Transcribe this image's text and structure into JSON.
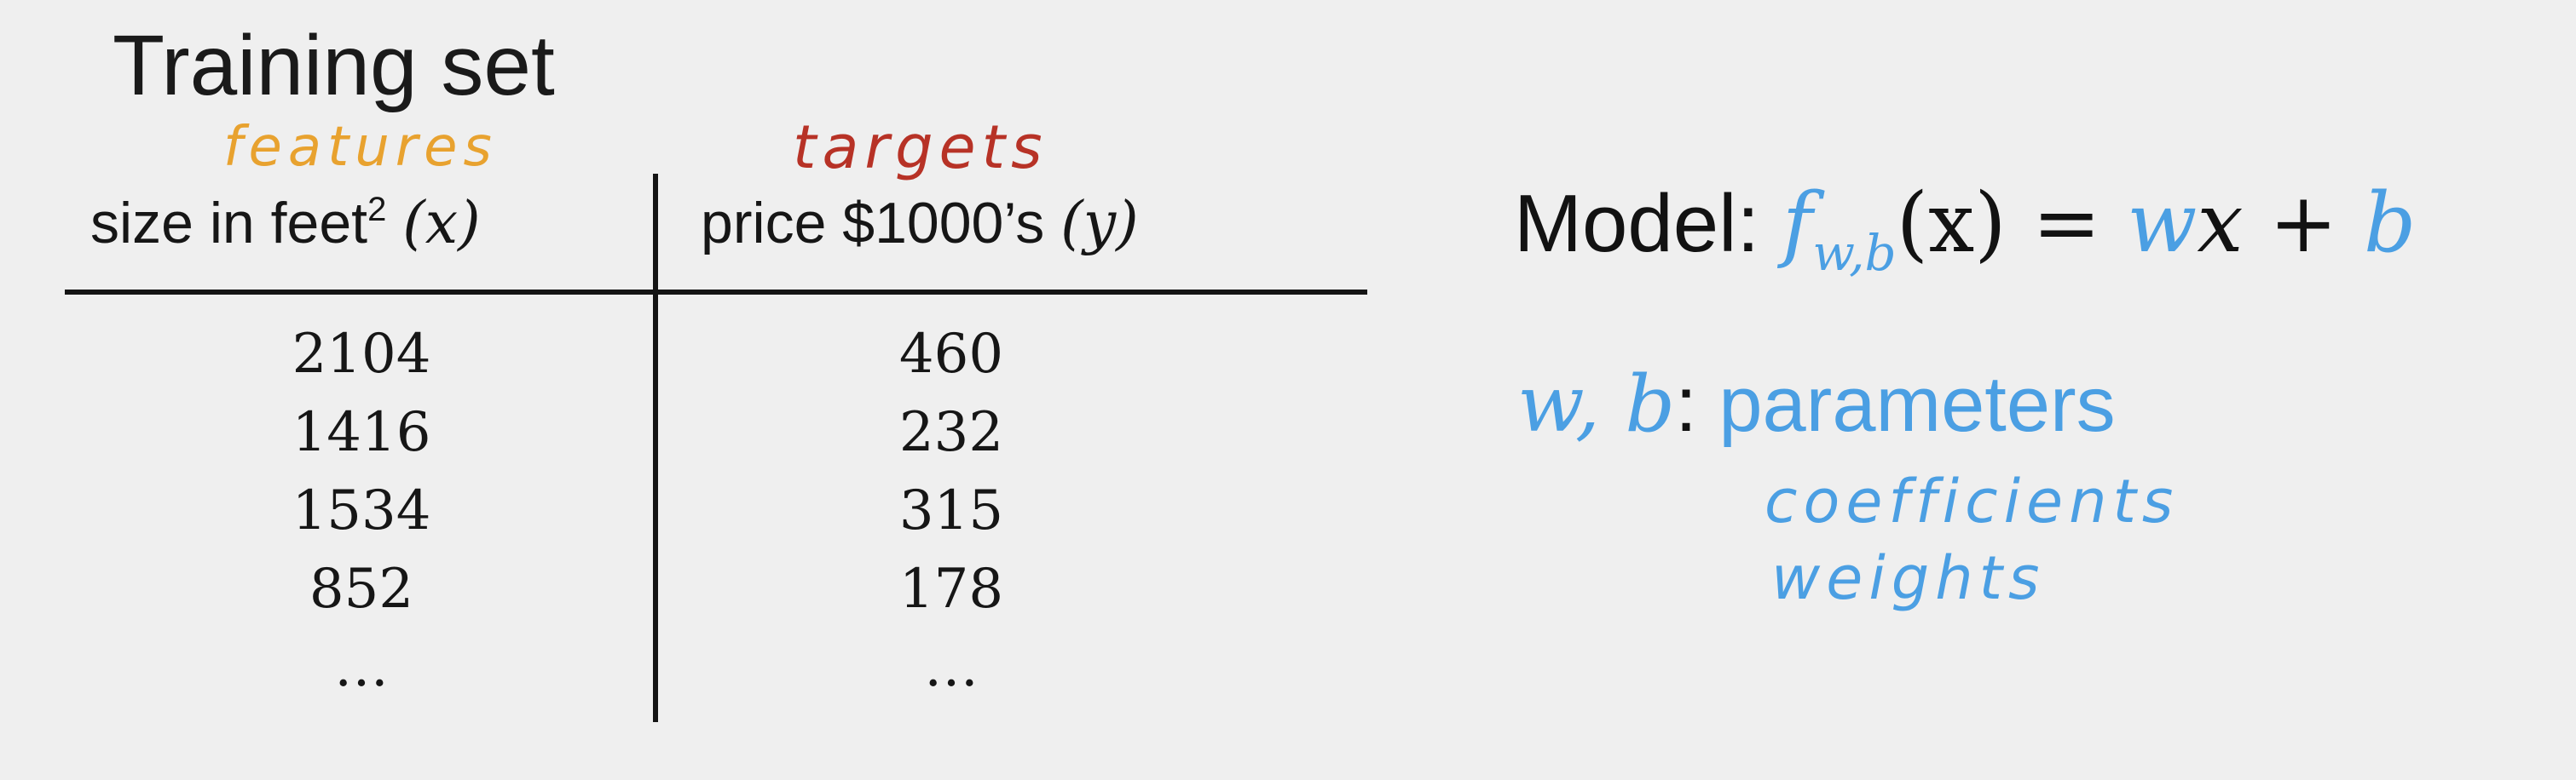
{
  "title": "Training set",
  "annotations": {
    "features": "features",
    "targets": "targets",
    "coefficients": "coefficients",
    "weights": "weights"
  },
  "table": {
    "x_header": {
      "text": "size in feet",
      "superscript": "2",
      "var": "(x)"
    },
    "y_header": {
      "text": "price $1000’s",
      "var": "(y)"
    },
    "x_values": [
      "2104",
      "1416",
      "1534",
      "852",
      "…"
    ],
    "y_values": [
      "460",
      "232",
      "315",
      "178",
      "…"
    ]
  },
  "model": {
    "label": "Model:",
    "f": "f",
    "subscript": "w,b",
    "arg": "(x)",
    "eq": " = ",
    "w": "w",
    "x": "x",
    "plus": " + ",
    "b": "b"
  },
  "params": {
    "vars": "w, b",
    "colon": ":",
    "label": "parameters"
  },
  "colors": {
    "features": "#e8a22f",
    "targets": "#b73226",
    "accent_blue": "#4b9fe3",
    "text": "#111111",
    "background": "#efefef"
  }
}
